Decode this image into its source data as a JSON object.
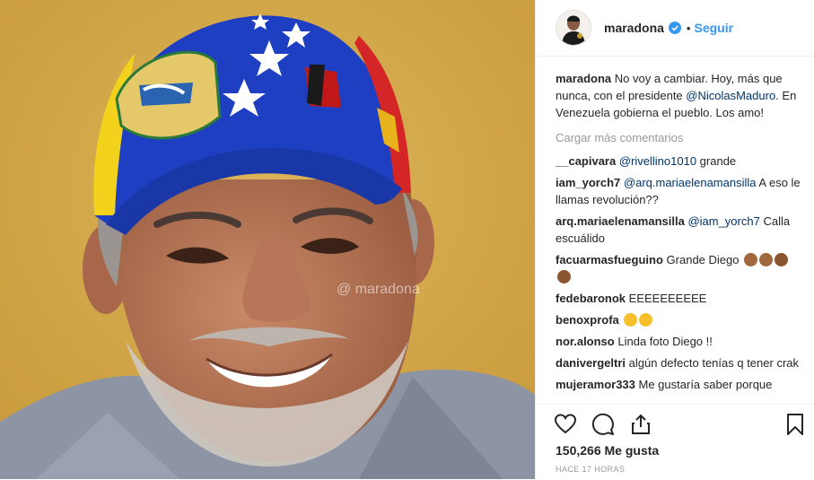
{
  "post": {
    "username": "maradona",
    "follow_label": "Seguir",
    "dot": "•",
    "watermark": "@ maradona"
  },
  "caption": {
    "username": "maradona",
    "text_before": "No voy a cambiar. Hoy, más que nunca, con el presidente ",
    "mention": "@NicolasMaduro",
    "text_after": ". En Venezuela gobierna el pueblo. Los amo!"
  },
  "load_more": "Cargar más comentarios",
  "comments": [
    {
      "user": "__capivara",
      "mention": "@rivellino1010",
      "text": " grande"
    },
    {
      "user": "iam_yorch7",
      "mention": "@arq.mariaelenamansilla",
      "text": " A eso le llamas revolución??"
    },
    {
      "user": "arq.mariaelenamansilla",
      "mention": "@iam_yorch7",
      "text": " Calla escuálido"
    },
    {
      "user": "facuarmasfueguino",
      "mention": "",
      "text": "Grande Diego"
    },
    {
      "user": "fedebaronok",
      "mention": "",
      "text": "EEEEEEEEEE"
    },
    {
      "user": "benoxprofa",
      "mention": "",
      "text": ""
    },
    {
      "user": "nor.alonso",
      "mention": "",
      "text": "Linda foto Diego !!"
    },
    {
      "user": "danivergeltri",
      "mention": "",
      "text": "algún defecto tenías q tener crak"
    },
    {
      "user": "mujeramor333",
      "mention": "",
      "text": "Me gustaría saber porque"
    }
  ],
  "likes": "150,266 Me gusta",
  "timestamp": "HACE 17 HORAS",
  "colors": {
    "accent": "#3897f0",
    "mention": "#003569",
    "muted": "#999999"
  }
}
